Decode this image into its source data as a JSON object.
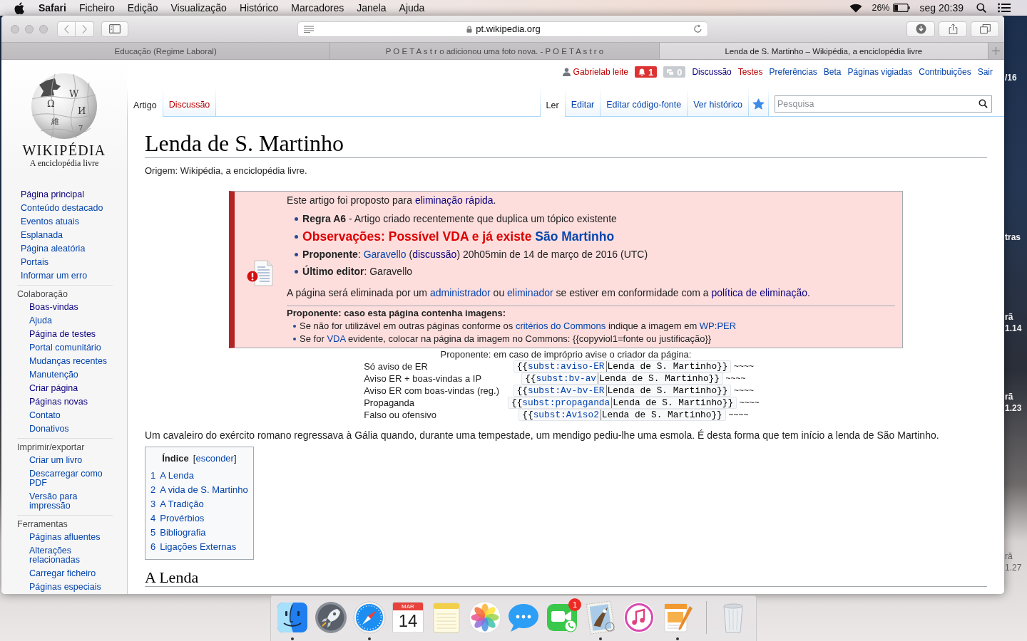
{
  "menu_bar": {
    "app": "Safari",
    "menus": [
      "Ficheiro",
      "Edição",
      "Visualização",
      "Histórico",
      "Marcadores",
      "Janela",
      "Ajuda"
    ],
    "battery": "26%",
    "clock": "seg 20:39"
  },
  "browser": {
    "address": "pt.wikipedia.org",
    "tabs": [
      {
        "title": "Educação (Regime Laboral)",
        "selected": false
      },
      {
        "title": "P O E T A s t r o adicionou uma foto nova. - P O E T A s t r o",
        "selected": false
      },
      {
        "title": "Lenda de S. Martinho – Wikipédia, a enciclopédia livre",
        "selected": true
      }
    ]
  },
  "wiki": {
    "logo": {
      "glyphs": [
        "Ω",
        "W",
        "И",
        "維",
        "7"
      ],
      "wordmark": "WIKIPÉDIA",
      "tagline": "A enciclopédia livre"
    },
    "personal_tools": {
      "user": {
        "label": "Gabrielab leite",
        "kind": "new"
      },
      "badges": [
        {
          "kind": "alert",
          "count": "1",
          "active": true
        },
        {
          "kind": "notice",
          "count": "0",
          "active": false
        }
      ],
      "links": [
        {
          "label": "Discussão",
          "kind": "visited"
        },
        {
          "label": "Testes",
          "kind": "new"
        },
        {
          "label": "Preferências",
          "kind": "link"
        },
        {
          "label": "Beta",
          "kind": "link"
        },
        {
          "label": "Páginas vigiadas",
          "kind": "link"
        },
        {
          "label": "Contribuições",
          "kind": "link"
        },
        {
          "label": "Sair",
          "kind": "link"
        }
      ]
    },
    "namespaces": [
      {
        "label": "Artigo",
        "selected": true,
        "kind": "link"
      },
      {
        "label": "Discussão",
        "selected": false,
        "kind": "new"
      }
    ],
    "views": [
      {
        "label": "Ler",
        "selected": true
      },
      {
        "label": "Editar",
        "selected": false
      },
      {
        "label": "Editar código-fonte",
        "selected": false
      },
      {
        "label": "Ver histórico",
        "selected": false
      }
    ],
    "watched": true,
    "search": {
      "placeholder": "Pesquisa"
    },
    "sidebar": [
      {
        "items": [
          {
            "label": "Página principal",
            "kind": "visited"
          },
          {
            "label": "Conteúdo destacado",
            "kind": "link"
          },
          {
            "label": "Eventos atuais",
            "kind": "link"
          },
          {
            "label": "Esplanada",
            "kind": "link"
          },
          {
            "label": "Página aleatória",
            "kind": "link"
          },
          {
            "label": "Portais",
            "kind": "link"
          },
          {
            "label": "Informar um erro",
            "kind": "link"
          }
        ]
      },
      {
        "heading": "Colaboração",
        "items": [
          {
            "label": "Boas-vindas",
            "kind": "visited"
          },
          {
            "label": "Ajuda",
            "kind": "link"
          },
          {
            "label": "Página de testes",
            "kind": "visited"
          },
          {
            "label": "Portal comunitário",
            "kind": "link"
          },
          {
            "label": "Mudanças recentes",
            "kind": "link"
          },
          {
            "label": "Manutenção",
            "kind": "link"
          },
          {
            "label": "Criar página",
            "kind": "visited"
          },
          {
            "label": "Páginas novas",
            "kind": "visited"
          },
          {
            "label": "Contato",
            "kind": "link"
          },
          {
            "label": "Donativos",
            "kind": "link"
          }
        ]
      },
      {
        "heading": "Imprimir/exportar",
        "items": [
          {
            "label": "Criar um livro",
            "kind": "link"
          },
          {
            "label": "Descarregar como PDF",
            "kind": "link"
          },
          {
            "label": "Versão para impressão",
            "kind": "link"
          }
        ]
      },
      {
        "heading": "Ferramentas",
        "items": [
          {
            "label": "Páginas afluentes",
            "kind": "link"
          },
          {
            "label": "Alterações relacionadas",
            "kind": "link"
          },
          {
            "label": "Carregar ficheiro",
            "kind": "link"
          },
          {
            "label": "Páginas especiais",
            "kind": "link"
          }
        ]
      }
    ],
    "article": {
      "title": "Lenda de S. Martinho",
      "subtitle": "Origem: Wikipédia, a enciclopédia livre.",
      "notice": {
        "intro": [
          {
            "text": "Este artigo foi proposto para ",
            "kind": "text"
          },
          {
            "text": "eliminação rápida",
            "kind": "visited"
          },
          {
            "text": ".",
            "kind": "text"
          }
        ],
        "bullets": [
          {
            "kind": "plain",
            "segments": [
              {
                "text": "**Regra A6** - Artigo criado recentemente que duplica um tópico existente",
                "kind": "text"
              }
            ]
          },
          {
            "kind": "highlight",
            "segments": [
              {
                "text": "Observações: Possível VDA e já existe ",
                "kind": "text"
              },
              {
                "text": "São Martinho",
                "kind": "link"
              }
            ]
          },
          {
            "kind": "plain",
            "segments": [
              {
                "text": "**Proponente**: ",
                "kind": "text"
              },
              {
                "text": "Garavello",
                "kind": "link"
              },
              {
                "text": " (",
                "kind": "text"
              },
              {
                "text": "discussão",
                "kind": "visited"
              },
              {
                "text": ") 20h05min de 14 de março de 2016 (UTC)",
                "kind": "text"
              }
            ]
          },
          {
            "kind": "plain",
            "segments": [
              {
                "text": "**Último editor**: Garavello",
                "kind": "text"
              }
            ]
          }
        ],
        "outro": [
          {
            "text": "A página será eliminada por um ",
            "kind": "text"
          },
          {
            "text": "administrador",
            "kind": "link"
          },
          {
            "text": " ou ",
            "kind": "text"
          },
          {
            "text": "eliminador",
            "kind": "link"
          },
          {
            "text": " se estiver em conformidade com a ",
            "kind": "text"
          },
          {
            "text": "política de eliminação",
            "kind": "visited"
          },
          {
            "text": ".",
            "kind": "text"
          }
        ],
        "images_heading": "Proponente: caso esta página contenha imagens:",
        "image_bullets": [
          [
            {
              "text": "Se não for utilizável em outras páginas conforme os ",
              "kind": "text"
            },
            {
              "text": "critérios do Commons",
              "kind": "link"
            },
            {
              "text": " indique a imagem em ",
              "kind": "text"
            },
            {
              "text": "WP:PER",
              "kind": "link"
            }
          ],
          [
            {
              "text": "Se for ",
              "kind": "text"
            },
            {
              "text": "VDA",
              "kind": "link"
            },
            {
              "text": " evidente, colocar na página da imagem no Commons: {{copyviol1=fonte ou justificação}}",
              "kind": "text"
            }
          ]
        ]
      },
      "templates": {
        "caption": "Proponente: em caso de impróprio avise o criador da página:",
        "rows": [
          {
            "label": "Só aviso de ER",
            "open": "{{",
            "template": "subst:aviso-ER",
            "argument": "Lenda de S. Martinho",
            "close": "}}",
            "signature": "~~~~"
          },
          {
            "label": "Aviso ER + boas-vindas a IP",
            "open": "{{",
            "template": "subst:bv-av",
            "argument": "Lenda de S. Martinho",
            "close": "}}",
            "signature": "~~~~"
          },
          {
            "label": "Aviso ER com boas-vindas (reg.)",
            "open": "{{",
            "template": "subst:Av-bv-ER",
            "argument": "Lenda de S. Martinho",
            "close": "}}",
            "signature": "~~~~"
          },
          {
            "label": "Propaganda",
            "open": "{{",
            "template": "subst:propaganda",
            "argument": "Lenda de S. Martinho",
            "close": "}}",
            "signature": "~~~~"
          },
          {
            "label": "Falso ou ofensivo",
            "open": "{{",
            "template": "subst:Aviso2",
            "argument": "Lenda de S. Martinho",
            "close": "}}",
            "signature": "~~~~"
          }
        ]
      },
      "paragraph": "Um cavaleiro do exército romano regressava à Gália quando, durante uma tempestade, um mendigo pediu-lhe uma esmola. É desta forma que tem início a lenda de São Martinho.",
      "toc": {
        "title": "Índice",
        "toggle_open": "[",
        "toggle": "esconder",
        "toggle_close": "]",
        "items": [
          {
            "number": "1",
            "label": "A Lenda"
          },
          {
            "number": "2",
            "label": "A vida de S. Martinho"
          },
          {
            "number": "3",
            "label": "A Tradição"
          },
          {
            "number": "4",
            "label": "Provérbios"
          },
          {
            "number": "5",
            "label": "Bibliografia"
          },
          {
            "number": "6",
            "label": "Ligações Externas"
          }
        ]
      },
      "section_heading": "A Lenda"
    }
  },
  "dock": [
    {
      "kind": "finder",
      "running": true
    },
    {
      "kind": "launchpad",
      "running": false
    },
    {
      "kind": "safari",
      "running": true
    },
    {
      "kind": "calendar",
      "running": false,
      "month": "MAR",
      "day": "14"
    },
    {
      "kind": "notes",
      "running": false
    },
    {
      "kind": "photos",
      "running": false
    },
    {
      "kind": "messages",
      "running": false
    },
    {
      "kind": "facetime",
      "running": false,
      "badge": "1"
    },
    {
      "kind": "mail",
      "running": true
    },
    {
      "kind": "itunes",
      "running": false
    },
    {
      "kind": "pages",
      "running": true
    },
    {
      "kind": "trash",
      "running": false
    }
  ],
  "desktop_fragments": [
    [
      "/16"
    ],
    [
      "tras"
    ],
    [
      "rã",
      "1.14"
    ],
    [
      "rã",
      "1.23"
    ],
    [
      "rã",
      "1.27"
    ]
  ]
}
